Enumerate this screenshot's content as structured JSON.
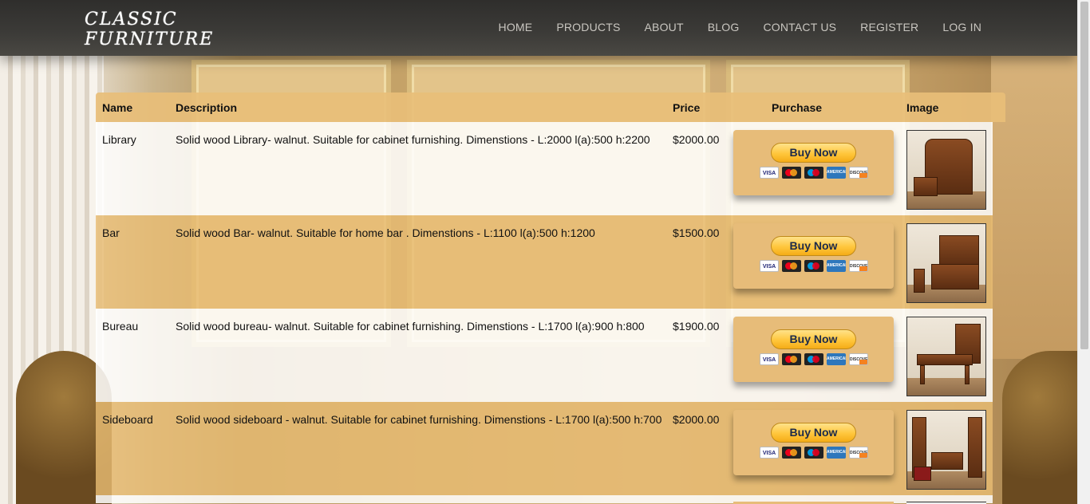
{
  "header": {
    "logo_line1": "CLASSIC",
    "logo_line2": "FURNITURE",
    "nav": [
      "HOME",
      "PRODUCTS",
      "ABOUT",
      "BLOG",
      "CONTACT US",
      "REGISTER",
      "LOG IN"
    ]
  },
  "table": {
    "columns": [
      "Name",
      "Description",
      "Price",
      "Purchase",
      "Image"
    ],
    "rows": [
      {
        "name": "Library",
        "description": "Solid wood Library- walnut. Suitable for cabinet furnishing. Dimenstions - L:2000 l(a):500 h:2200",
        "price": "$2000.00",
        "button": "Buy Now"
      },
      {
        "name": "Bar",
        "description": "Solid wood Bar- walnut. Suitable for home bar . Dimenstions - L:1100 l(a):500 h:1200",
        "price": "$1500.00",
        "button": "Buy Now"
      },
      {
        "name": "Bureau",
        "description": "Solid wood bureau- walnut. Suitable for cabinet furnishing. Dimenstions - L:1700 l(a):900 h:800",
        "price": "$1900.00",
        "button": "Buy Now"
      },
      {
        "name": "Sideboard",
        "description": "Solid wood sideboard - walnut. Suitable for cabinet furnishing. Dimenstions - L:1700 l(a):500 h:700",
        "price": "$2000.00",
        "button": "Buy Now"
      }
    ]
  },
  "payment_cards": {
    "visa": "VISA",
    "amex": "AMERICAN EXPRESS",
    "discover": "DISCOVER"
  }
}
